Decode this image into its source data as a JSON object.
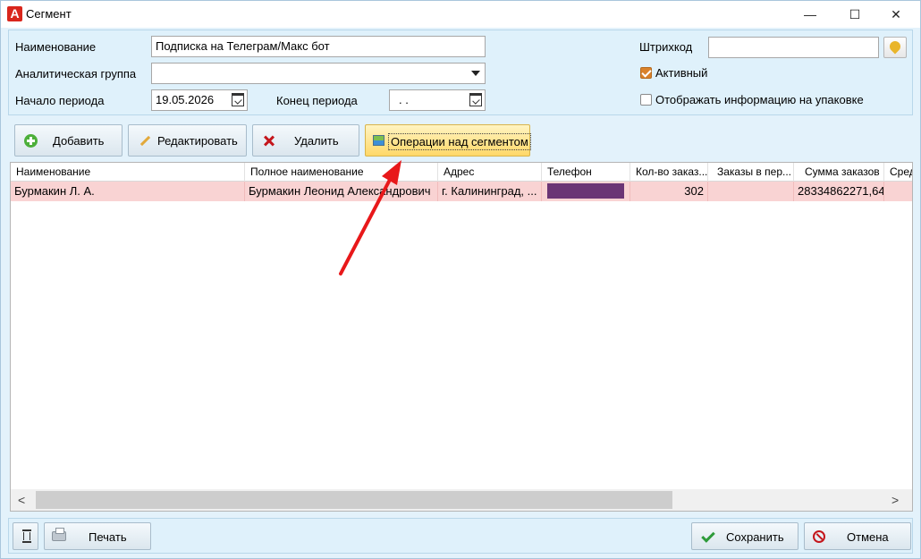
{
  "window": {
    "title": "Сегмент",
    "logo": "A",
    "minimize": "—",
    "maximize": "☐",
    "close": "✕"
  },
  "form": {
    "name_label": "Наименование",
    "name_value": "Подписка на Телеграм/Макс бот",
    "group_label": "Аналитическая группа",
    "group_value": "",
    "start_label": "Начало периода",
    "start_value": "19.05.2026",
    "end_label": "Конец периода",
    "end_value": ". .",
    "barcode_label": "Штрихкод",
    "barcode_value": "",
    "active_label": "Активный",
    "active_checked": true,
    "pack_label": "Отображать информацию на упаковке",
    "pack_checked": false
  },
  "toolbar": {
    "add": "Добавить",
    "edit": "Редактировать",
    "delete": "Удалить",
    "ops": "Операции над сегментом"
  },
  "grid": {
    "columns": [
      "Наименование",
      "Полное наименование",
      "Адрес",
      "Телефон",
      "Кол-во заказ...",
      "Заказы в пер...",
      "Сумма заказов",
      "Сред"
    ],
    "rows": [
      {
        "name": "Бурмакин Л. А.",
        "full_name": "Бурмакин Леонид Александрович",
        "address": "г. Калининград, ...",
        "phone": "",
        "orders_count": "302",
        "orders_period": "",
        "orders_sum": "28334862271,64",
        "avg": ""
      }
    ]
  },
  "scroll": {
    "left": "<",
    "right": ">"
  },
  "bottom": {
    "print": "Печать",
    "save": "Сохранить",
    "cancel": "Отмена"
  },
  "colors": {
    "selected_row": "#f9d3d3",
    "accent": "#ffd868",
    "annotation_arrow": "#e8181a"
  }
}
